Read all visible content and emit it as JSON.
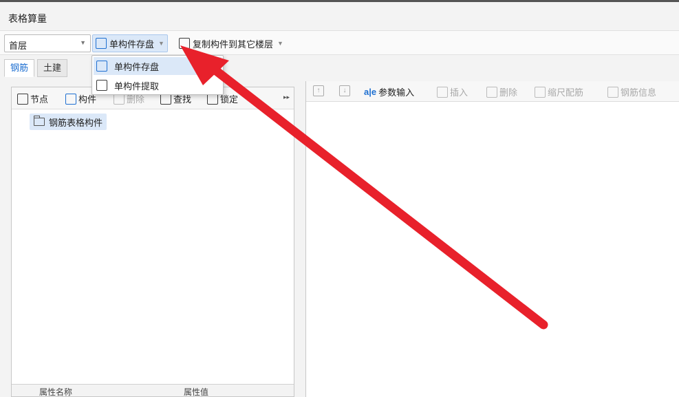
{
  "window": {
    "title": "表格算量"
  },
  "toolbar": {
    "floor_value": "首层",
    "save_single_label": "单构件存盘",
    "copy_to_floor_label": "复制构件到其它楼层"
  },
  "tabs": [
    {
      "label": "钢筋"
    },
    {
      "label": "土建"
    }
  ],
  "left_toolbar": {
    "node_label": "节点",
    "component_label": "构件",
    "delete_label": "删除",
    "find_label": "查找",
    "lock_label": "锁定"
  },
  "tree": {
    "items": [
      {
        "label": "钢筋表格构件"
      }
    ]
  },
  "left_footer": {
    "col1": "属性名称",
    "col2": "属性值"
  },
  "right_toolbar": {
    "param_input_label": "参数输入",
    "insert_label": "插入",
    "delete_label": "删除",
    "scale_rebar_label": "缩尺配筋",
    "rebar_info_label": "钢筋信息"
  },
  "dropdown_menu": {
    "items": [
      {
        "label": "单构件存盘"
      },
      {
        "label": "单构件提取"
      }
    ]
  },
  "annotation": {
    "arrow_color": "#e8212b"
  }
}
